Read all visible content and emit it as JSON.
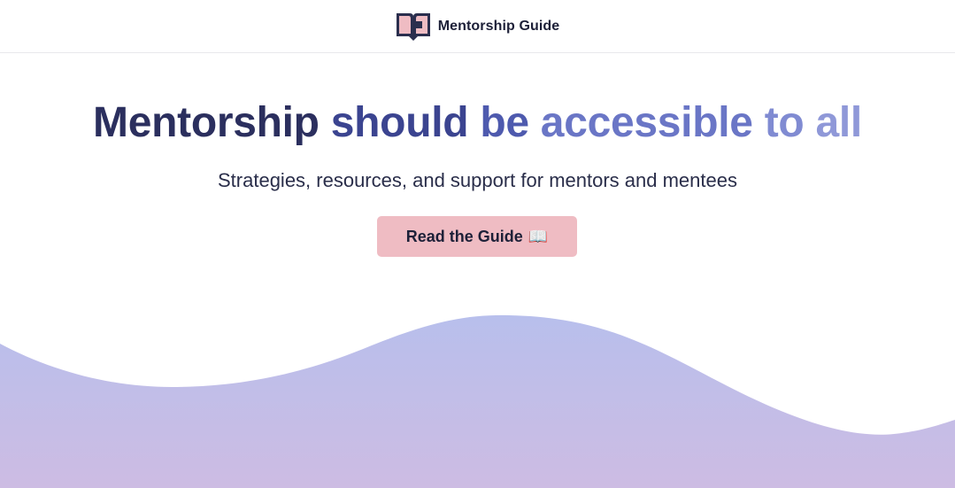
{
  "header": {
    "brand_name": "Mentorship Guide",
    "logo_icon": "open-book-logo-icon"
  },
  "hero": {
    "title_words": [
      "Mentorship",
      "should",
      "be",
      "accessible",
      "to",
      "all"
    ],
    "title_word_colors": [
      "#2b2f5e",
      "#3b4490",
      "#4e5aae",
      "#6a76c6",
      "#808bd2",
      "#8f98d8"
    ],
    "subtitle": "Strategies, resources, and support for mentors and mentees",
    "cta_label": "Read the Guide",
    "cta_icon": "📖"
  },
  "colors": {
    "cta_background": "#efbcc3",
    "wave_top": "#b8bfec",
    "wave_bottom": "#cdbce3",
    "logo_dark": "#2b2f4e",
    "logo_pink": "#efbcc3"
  }
}
